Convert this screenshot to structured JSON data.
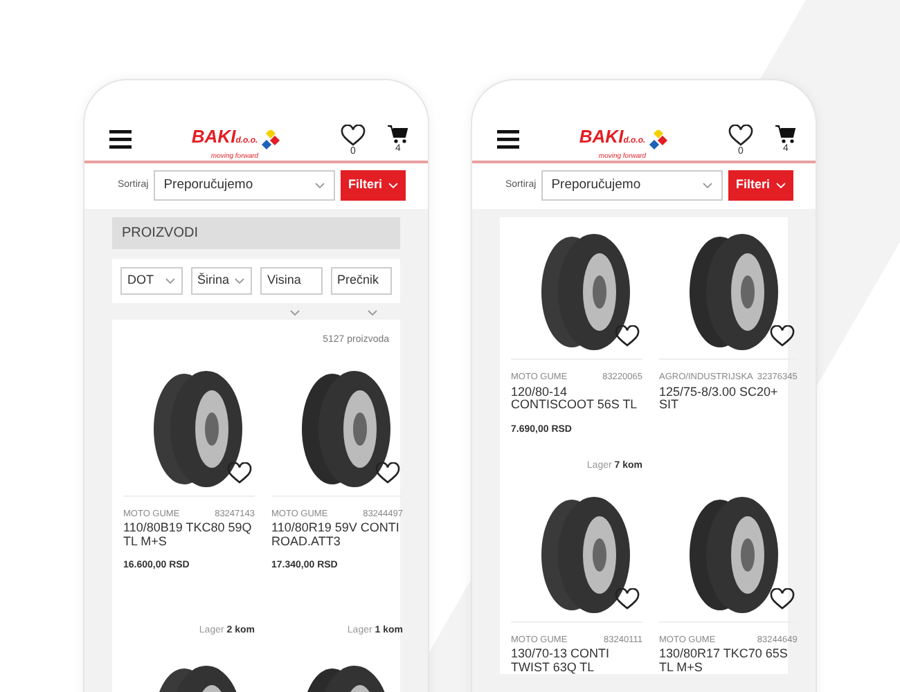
{
  "phones": [
    {
      "header": {
        "logo": "BAKI",
        "logo_suffix": "d.o.o.",
        "tagline": "moving forward",
        "wishlist_count": "0",
        "cart_count": "4"
      },
      "sort": {
        "label": "Sortiraj",
        "value": "Preporučujemo"
      },
      "filter_button": "Filteri",
      "section_title": "PROIZVODI",
      "filters": [
        {
          "label": "DOT",
          "kind": "inline"
        },
        {
          "label": "Širina",
          "kind": "inline"
        },
        {
          "label": "Visina",
          "kind": "offset"
        },
        {
          "label": "Prečnik",
          "kind": "offset"
        }
      ],
      "count": "5127 proizvoda",
      "products": [
        {
          "kind": "full",
          "category": "MOTO GUME",
          "code": "83247143",
          "name": "110/80B19 TKC80 59Q TL M+S",
          "price": "16.600,00 RSD",
          "stock_label": "Lager",
          "stock": "2 kom"
        },
        {
          "kind": "full",
          "category": "MOTO GUME",
          "code": "83244497",
          "name": "110/80R19 59V CONTI ROAD.ATT3",
          "price": "17.340,00 RSD",
          "stock_label": "Lager",
          "stock": "1 kom"
        },
        {
          "kind": "image-only"
        },
        {
          "kind": "image-only"
        }
      ]
    },
    {
      "header": {
        "logo": "BAKI",
        "logo_suffix": "d.o.o.",
        "tagline": "moving forward",
        "wishlist_count": "0",
        "cart_count": "4"
      },
      "sort": {
        "label": "Sortiraj",
        "value": "Preporučujemo"
      },
      "filter_button": "Filteri",
      "products": [
        {
          "kind": "full",
          "category": "MOTO GUME",
          "code": "83220065",
          "name": "120/80-14 CONTISCOOT 56S TL",
          "price": "7.690,00 RSD",
          "stock_label": "Lager",
          "stock": "7 kom"
        },
        {
          "kind": "full",
          "category": "AGRO/INDUSTRIJSKA",
          "code": "32376345",
          "name": "125/75-8/3.00 SC20+ SIT"
        },
        {
          "kind": "full",
          "category": "MOTO GUME",
          "code": "83240111",
          "name": "130/70-13 CONTI TWIST 63Q TL"
        },
        {
          "kind": "full",
          "category": "MOTO GUME",
          "code": "83244649",
          "name": "130/80R17 TKC70 65S TL M+S"
        }
      ]
    }
  ]
}
